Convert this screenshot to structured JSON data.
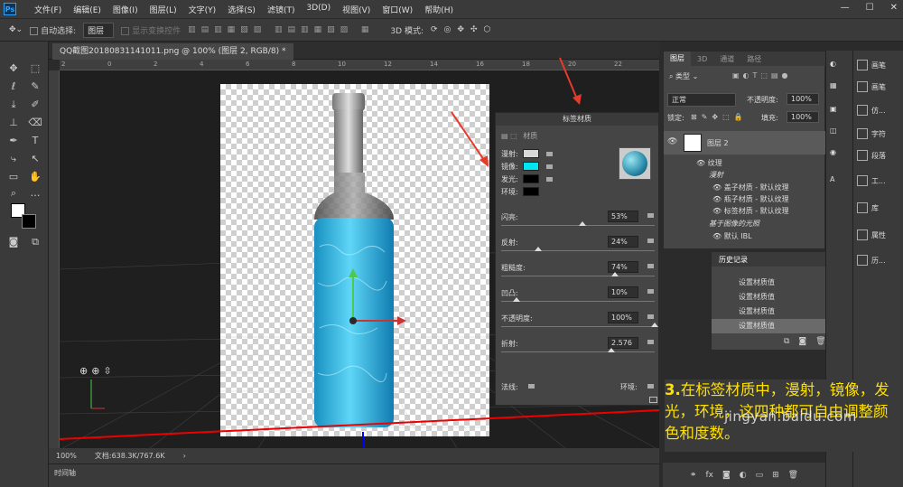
{
  "app": {
    "logo_text": "Ps"
  },
  "menu": [
    "文件(F)",
    "编辑(E)",
    "图像(I)",
    "图层(L)",
    "文字(Y)",
    "选择(S)",
    "滤镜(T)",
    "3D(D)",
    "视图(V)",
    "窗口(W)",
    "帮助(H)"
  ],
  "options_bar": {
    "auto_select_label": "自动选择:",
    "auto_select_value": "图层",
    "show_transform_label": "显示变换控件",
    "mode_label": "3D 模式:"
  },
  "document_tab": {
    "title": "QQ截图20180831141011.png @ 100% (图层 2, RGB/8) *"
  },
  "ruler_marks": [
    "2",
    "0",
    "2",
    "4",
    "6",
    "8",
    "10",
    "12",
    "14",
    "16",
    "18",
    "20",
    "22"
  ],
  "status": {
    "zoom": "100%",
    "doc_size": "文档:638.3K/767.6K"
  },
  "timeline_label": "时间轴",
  "properties": {
    "title": "标签材质",
    "tab_label": "材质",
    "diffuse_label": "漫射:",
    "specular_label": "镜像:",
    "glow_label": "发光:",
    "ambient_label": "环境:",
    "shine_label": "闪亮:",
    "shine_value": "53%",
    "reflect_label": "反射:",
    "reflect_value": "24%",
    "rough_label": "粗糙度:",
    "rough_value": "74%",
    "bump_label": "凹凸:",
    "bump_value": "10%",
    "opacity_label": "不透明度:",
    "opacity_value": "100%",
    "refract_label": "折射:",
    "refract_value": "2.576",
    "normal_label": "法线:",
    "env_label": "环境:",
    "colors": {
      "diffuse": "#d8d8d8",
      "specular": "#00e5ef",
      "glow": "#000000",
      "ambient": "#000000"
    },
    "sliders": {
      "shine": 0.53,
      "reflect": 0.24,
      "rough": 0.74,
      "bump": 0.1,
      "opacity": 1.0,
      "refract": 0.72
    }
  },
  "layers_panel": {
    "tabs": [
      "图层",
      "3D",
      "通道",
      "路径"
    ],
    "filter_label": "类型",
    "blend_mode": "正常",
    "opacity_label": "不透明度:",
    "opacity_value": "100%",
    "lock_label": "锁定:",
    "fill_label": "填充:",
    "fill_value": "100%",
    "layer_name": "图层 2",
    "texture_label": "纹理",
    "diffuse_group": "漫射",
    "items": [
      "盖子材质 - 默认纹理",
      "瓶子材质 - 默认纹理",
      "标签材质 - 默认纹理"
    ],
    "ibl_label": "基于图像的光照",
    "ibl_item": "默认 IBL"
  },
  "history": {
    "title": "历史记录",
    "items": [
      "设置材质值",
      "设置材质值",
      "设置材质值",
      "设置材质值"
    ]
  },
  "dock": [
    "画笔",
    "画笔",
    "仿...",
    "字符",
    "段落",
    "工...",
    "库",
    "属性",
    "历..."
  ],
  "caption": {
    "number": "3.",
    "text": "在标签材质中，漫射，镜像，发光，环境，这四种都可自由调整颜色和度数。"
  },
  "watermark": "jingyan.baidu.com"
}
